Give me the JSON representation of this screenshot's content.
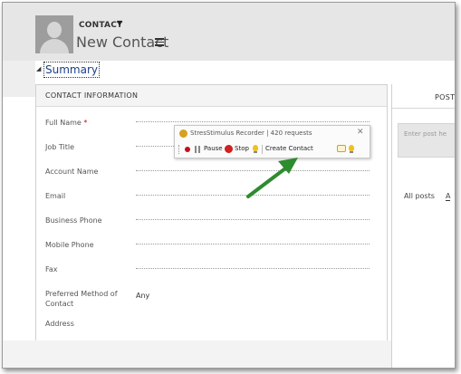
{
  "header": {
    "entity_label": "CONTACT",
    "record_title": "New Contact"
  },
  "summary": {
    "label": "Summary"
  },
  "contact_section": {
    "title": "CONTACT INFORMATION",
    "fields": [
      {
        "label": "Full Name",
        "required_mark": "*",
        "value": ""
      },
      {
        "label": "Job Title",
        "value": ""
      },
      {
        "label": "Account Name",
        "value": ""
      },
      {
        "label": "Email",
        "value": ""
      },
      {
        "label": "Business Phone",
        "value": ""
      },
      {
        "label": "Mobile Phone",
        "value": ""
      },
      {
        "label": "Fax",
        "value": ""
      },
      {
        "label": "Preferred Method of Contact",
        "value": "Any"
      },
      {
        "label": "Address",
        "value": ""
      }
    ]
  },
  "posts": {
    "tab_label": "POST",
    "input_placeholder": "Enter post he",
    "filter_all": "All posts",
    "filter_next": "A"
  },
  "recorder": {
    "title": "StresStimulus Recorder | 420 requests",
    "close_icon": "✕",
    "pause_label": "Pause",
    "stop_label": "Stop",
    "transaction_label": "Create Contact"
  },
  "colors": {
    "accent_link": "#1a3f8a",
    "arrow": "#2e8b2e",
    "required": "#dd0000"
  }
}
